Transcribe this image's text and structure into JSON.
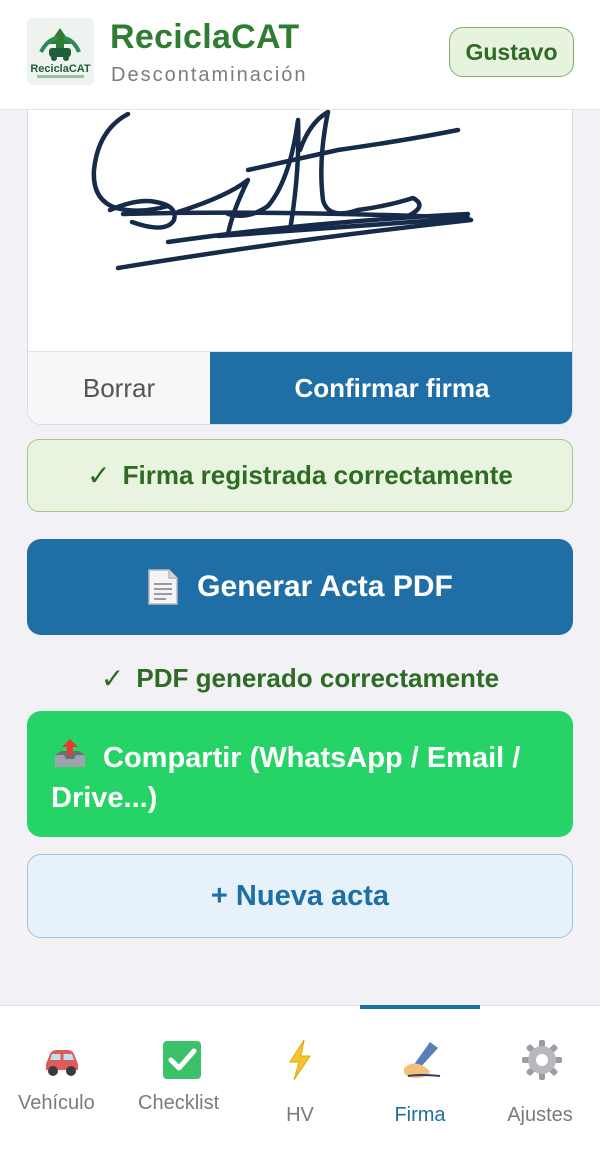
{
  "header": {
    "logo_text": "ReciclaCAT",
    "title": "ReciclaCAT",
    "subtitle": "Descontaminación",
    "user": "Gustavo"
  },
  "signature": {
    "clear_label": "Borrar",
    "confirm_label": "Confirmar firma"
  },
  "status": {
    "signature_ok": "Firma registrada correctamente",
    "check": "✓"
  },
  "actions": {
    "generate_pdf": "Generar Acta PDF",
    "pdf_ok": "PDF generado correctamente",
    "share": "Compartir (WhatsApp / Email / Drive...)",
    "new_act": "+ Nueva acta"
  },
  "nav": {
    "items": [
      {
        "label": "Vehículo",
        "icon": "car-icon"
      },
      {
        "label": "Checklist",
        "icon": "checkbox-icon"
      },
      {
        "label": "HV",
        "icon": "lightning-icon"
      },
      {
        "label": "Firma",
        "icon": "signature-hand-icon",
        "active": true
      },
      {
        "label": "Ajustes",
        "icon": "gear-icon"
      }
    ]
  },
  "colors": {
    "brand_green": "#2f7d32",
    "primary_blue": "#1f6ea6",
    "whatsapp_green": "#25d366"
  }
}
